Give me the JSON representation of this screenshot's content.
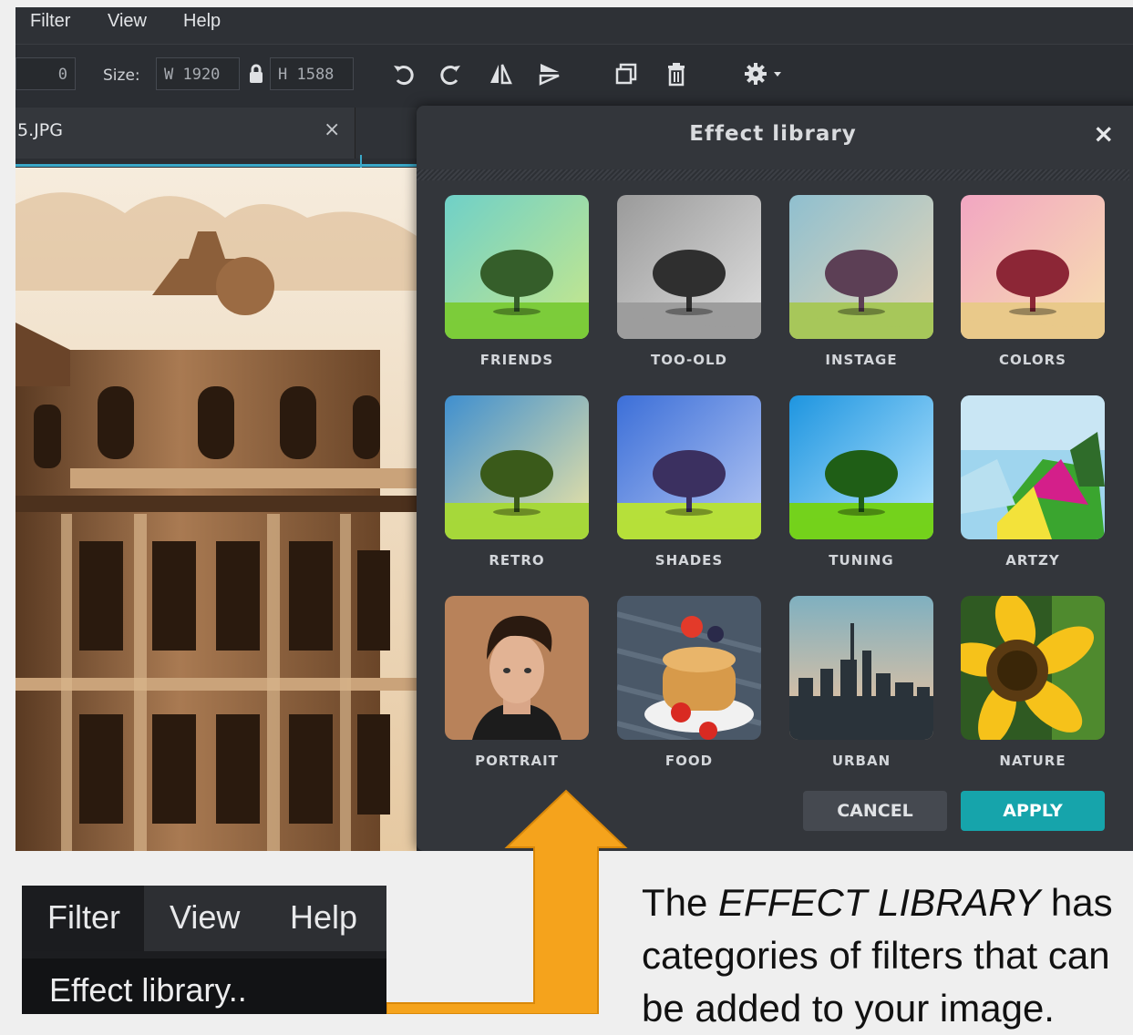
{
  "menubar": {
    "filter": "Filter",
    "view": "View",
    "help": "Help"
  },
  "toolbar": {
    "x_value": "0",
    "size_label": "Size:",
    "width_value": "W 1920",
    "height_value": "H 1588"
  },
  "tab": {
    "filename": "5.JPG",
    "close": "×"
  },
  "dialog": {
    "title": "Effect library",
    "close": "×",
    "effects": [
      {
        "label": "FRIENDS",
        "icon": "tree-teal-thumbnail"
      },
      {
        "label": "TOO-OLD",
        "icon": "tree-grayscale-thumbnail"
      },
      {
        "label": "INSTAGE",
        "icon": "tree-faded-thumbnail"
      },
      {
        "label": "COLORS",
        "icon": "tree-pink-thumbnail"
      },
      {
        "label": "RETRO",
        "icon": "tree-retro-thumbnail"
      },
      {
        "label": "SHADES",
        "icon": "tree-purple-thumbnail"
      },
      {
        "label": "TUNING",
        "icon": "tree-vivid-thumbnail"
      },
      {
        "label": "ARTZY",
        "icon": "abstract-thumbnail"
      },
      {
        "label": "PORTRAIT",
        "icon": "portrait-thumbnail"
      },
      {
        "label": "FOOD",
        "icon": "pancakes-thumbnail"
      },
      {
        "label": "URBAN",
        "icon": "city-thumbnail"
      },
      {
        "label": "NATURE",
        "icon": "sunflower-thumbnail"
      }
    ],
    "cancel": "CANCEL",
    "apply": "APPLY"
  },
  "mini_menu": {
    "filter": "Filter",
    "view": "View",
    "help": "Help",
    "item": "Effect library.."
  },
  "caption": {
    "part1": "The ",
    "emph": "EFFECT LIBRARY",
    "part2": " has categories of filters that can be added to your image."
  },
  "colors": {
    "accent": "#16a4ab",
    "arrow": "#f5a31c",
    "dialog_bg": "#33363b"
  }
}
